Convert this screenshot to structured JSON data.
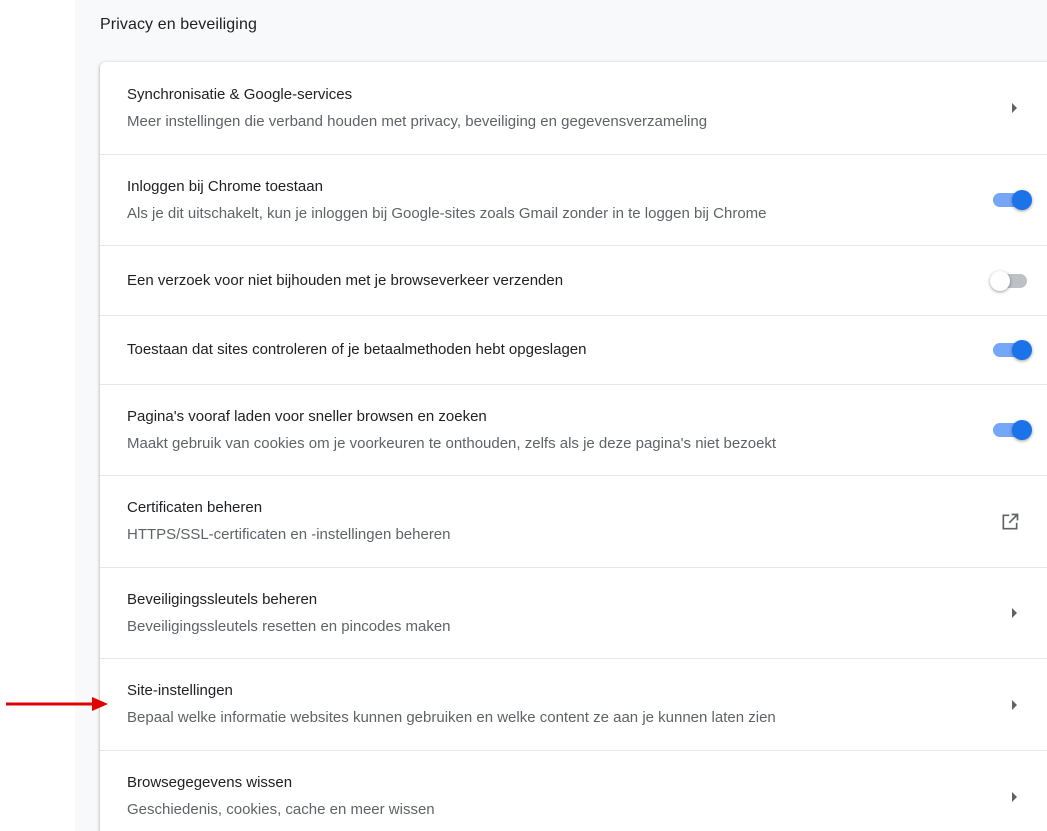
{
  "section": {
    "title": "Privacy en beveiliging"
  },
  "colors": {
    "accent": "#1a73e8",
    "annotation_arrow": "#e00000"
  },
  "rows": [
    {
      "title": "Synchronisatie & Google-services",
      "subtitle": "Meer instellingen die verband houden met privacy, beveiliging en gegevensverzameling",
      "control": "chevron-right-icon"
    },
    {
      "title": "Inloggen bij Chrome toestaan",
      "subtitle": "Als je dit uitschakelt, kun je inloggen bij Google-sites zoals Gmail zonder in te loggen bij Chrome",
      "control": "toggle",
      "checked": true
    },
    {
      "title": "Een verzoek voor niet bijhouden met je browseverkeer verzenden",
      "control": "toggle",
      "checked": false
    },
    {
      "title": "Toestaan dat sites controleren of je betaalmethoden hebt opgeslagen",
      "control": "toggle",
      "checked": true
    },
    {
      "title": "Pagina's vooraf laden voor sneller browsen en zoeken",
      "subtitle": "Maakt gebruik van cookies om je voorkeuren te onthouden, zelfs als je deze pagina's niet bezoekt",
      "control": "toggle",
      "checked": true
    },
    {
      "title": "Certificaten beheren",
      "subtitle": "HTTPS/SSL-certificaten en -instellingen beheren",
      "control": "open-in-new-icon"
    },
    {
      "title": "Beveiligingssleutels beheren",
      "subtitle": "Beveiligingssleutels resetten en pincodes maken",
      "control": "chevron-right-icon"
    },
    {
      "title": "Site-instellingen",
      "subtitle": "Bepaal welke informatie websites kunnen gebruiken en welke content ze aan je kunnen laten zien",
      "control": "chevron-right-icon"
    },
    {
      "title": "Browsegegevens wissen",
      "subtitle": "Geschiedenis, cookies, cache en meer wissen",
      "control": "chevron-right-icon"
    }
  ],
  "annotation": {
    "icon": "red-pointer-arrow-icon"
  }
}
